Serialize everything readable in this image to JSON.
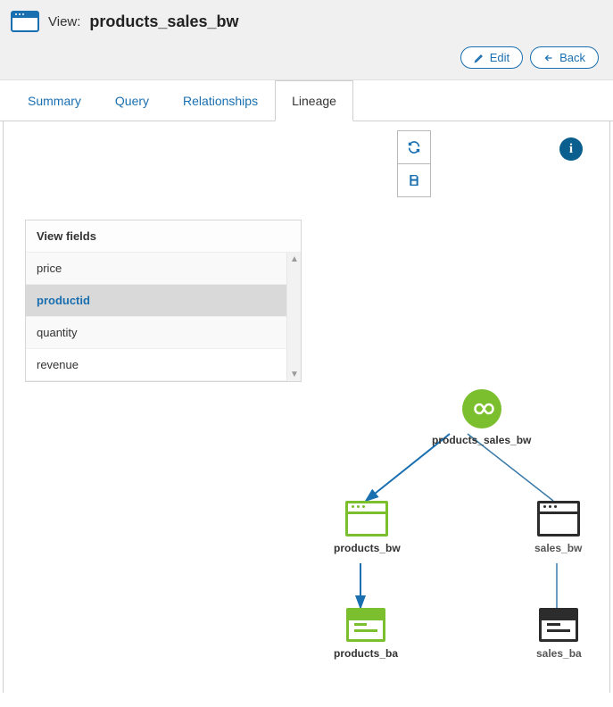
{
  "header": {
    "type_label": "View:",
    "view_name": "products_sales_bw",
    "edit_label": "Edit",
    "back_label": "Back"
  },
  "tabs": [
    {
      "label": "Summary",
      "active": false
    },
    {
      "label": "Query",
      "active": false
    },
    {
      "label": "Relationships",
      "active": false
    },
    {
      "label": "Lineage",
      "active": true
    }
  ],
  "fields_panel": {
    "title": "View fields",
    "fields": [
      {
        "name": "price",
        "selected": false
      },
      {
        "name": "productid",
        "selected": true
      },
      {
        "name": "quantity",
        "selected": false
      },
      {
        "name": "revenue",
        "selected": false
      }
    ]
  },
  "lineage": {
    "nodes": {
      "root": {
        "label": "products_sales_bw"
      },
      "products_bw": {
        "label": "products_bw"
      },
      "sales_bw": {
        "label": "sales_bw"
      },
      "products_ba": {
        "label": "products_ba"
      },
      "sales_ba": {
        "label": "sales_ba"
      }
    }
  }
}
